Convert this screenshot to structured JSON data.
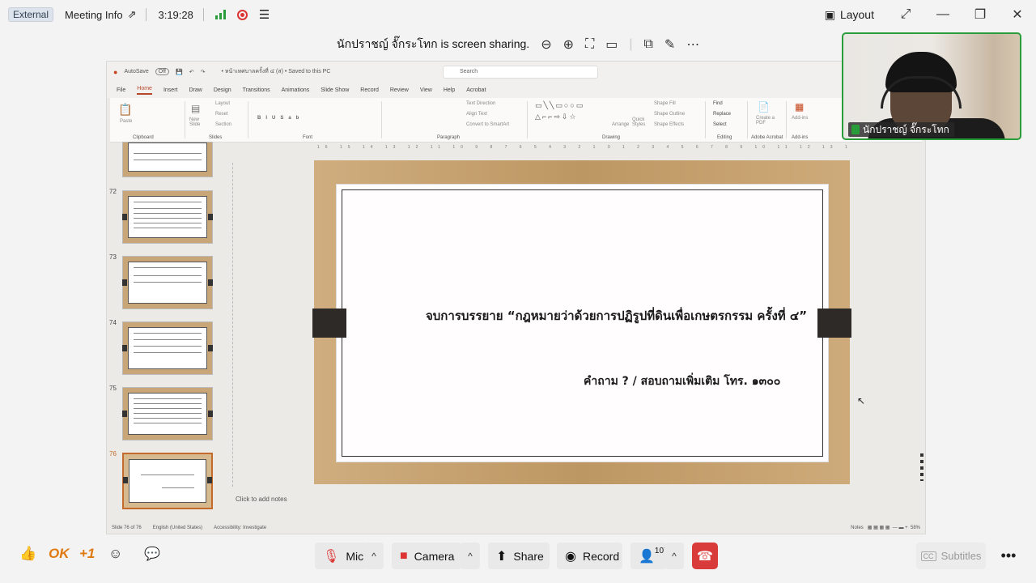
{
  "topbar": {
    "external_badge": "External",
    "meeting_info": "Meeting Info",
    "elapsed_time": "3:19:28",
    "layout_label": "Layout"
  },
  "share_banner": {
    "text": "นักปราชญ์ จั๊กระโทก is screen sharing."
  },
  "powerpoint": {
    "autosave_label": "AutoSave",
    "autosave_state": "Off",
    "doc_title": "• หน้าเทศบาลครั้งที่ ๔ (ส) • Saved to this PC",
    "search_placeholder": "Search",
    "menu_tabs": [
      "File",
      "Home",
      "Insert",
      "Draw",
      "Design",
      "Transitions",
      "Animations",
      "Slide Show",
      "Record",
      "Review",
      "View",
      "Help",
      "Acrobat"
    ],
    "ribbon_groups": [
      "Clipboard",
      "Slides",
      "Font",
      "Paragraph",
      "Drawing",
      "Editing",
      "Adobe Acrobat",
      "Add-ins"
    ],
    "ribbon_items": {
      "paste": "Paste",
      "new_slide": "New Slide",
      "layout": "Layout",
      "reset": "Reset",
      "section": "Section",
      "text_direction": "Text Direction",
      "align_text": "Align Text",
      "convert_smartart": "Convert to SmartArt",
      "arrange": "Arrange",
      "quick_styles": "Quick Styles",
      "shape_fill": "Shape Fill",
      "shape_outline": "Shape Outline",
      "shape_effects": "Shape Effects",
      "find": "Find",
      "replace": "Replace",
      "select": "Select",
      "create_pdf": "Create a PDF",
      "addins": "Add-ins"
    },
    "thumbnails": [
      {
        "num": "72"
      },
      {
        "num": "73"
      },
      {
        "num": "74"
      },
      {
        "num": "75"
      },
      {
        "num": "76"
      }
    ],
    "slide": {
      "line1": "จบการบรรยาย “กฎหมายว่าด้วยการปฏิรูปที่ดินเพื่อเกษตรกรรม ครั้งที่ ๔”",
      "line2": "คำถาม ? / สอบถามเพิ่มเติม โทร. ๑๓๐๐"
    },
    "notes_placeholder": "Click to add notes",
    "status": {
      "slide_count": "Slide 76 of 76",
      "language": "English (United States)",
      "accessibility": "Accessibility: Investigate",
      "notes": "Notes",
      "zoom": "58%"
    }
  },
  "camera": {
    "participant_name": "นักปราชญ์ จั๊กระโทก"
  },
  "bottombar": {
    "reactions": [
      "👍",
      "OK",
      "+1"
    ],
    "mic_label": "Mic",
    "camera_label": "Camera",
    "share_label": "Share",
    "record_label": "Record",
    "participants_count": "107",
    "subtitles_label": "Subtitles"
  },
  "colors": {
    "accent_green": "#2a9d3b",
    "end_call_red": "#d93a3a",
    "mic_muted_red": "#d33"
  }
}
